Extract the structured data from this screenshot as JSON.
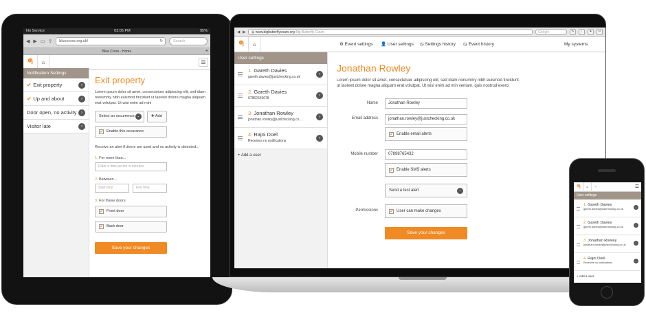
{
  "tablet": {
    "status": {
      "carrier": "No Service",
      "time": "03:05 PM",
      "battery": "95%"
    },
    "url": "bluecross.org.uk/",
    "search_placeholder": "Search",
    "tab_title": "Blue Cross - Home",
    "sidebar": {
      "heading": "Notification Settings",
      "items": [
        {
          "label": "Exit property",
          "checked": true
        },
        {
          "label": "Up and about",
          "checked": true
        },
        {
          "label": "Door open, no activity",
          "checked": false
        },
        {
          "label": "Visitor late",
          "checked": false
        }
      ]
    },
    "main": {
      "title": "Exit property",
      "lorem": "Lorem ipsum dolor sit amet, consectetuer adipiscing elit, sed diam nonummy nibh euismod tincidunt ut laoreet dolore magna aliquam erat volutpat. Ut wisi enim ad mini",
      "select_label": "Select an occurrence",
      "add_label": "Add",
      "enable_label": "Enable this occurance",
      "alert_text": "Receive an alert if doors are used and no activity is detected...",
      "step1": {
        "num": "1.",
        "label": "For more than..."
      },
      "step1_placeholder": "Enter a time period in minutes",
      "step2": {
        "num": "2.",
        "label": "Between..."
      },
      "start_placeholder": "Start time",
      "end_placeholder": "End time",
      "step3": {
        "num": "3.",
        "label": "For these doors"
      },
      "door1": "Front door",
      "door2": "Back door",
      "save": "Save your changes"
    }
  },
  "laptop": {
    "url_domain": "www.bigbutterflyexam.org",
    "url_title": "Big Butterfly Count",
    "search_placeholder": "Google",
    "nav": [
      "Event settings",
      "User settings",
      "Settings history",
      "Event history"
    ],
    "my_systems": "My systems",
    "users_heading": "User settings",
    "users": [
      {
        "num": "1.",
        "name": "Gareth Davies",
        "sub": "gareth.davies@justchecking.co.uk"
      },
      {
        "num": "2.",
        "name": "Gareth Davies",
        "sub": "07862345678"
      },
      {
        "num": "3.",
        "name": "Jonathan Rowley",
        "sub": "jonathan.rowley@justchecking.co..."
      },
      {
        "num": "4.",
        "name": "Rajni Doel",
        "sub": "Receives no notifications"
      }
    ],
    "add_user": "Add a user",
    "detail": {
      "title": "Jonathan Rowley",
      "lorem": "Lorem ipsum dolor sit amet, consectetuer adipiscing elit, sed diam nonummy nibh euismod tincidunt ut laoreet dolore magna aliquam erat volutpat. Ut wisi enim ad min veniam, quis nostrud exerci",
      "name_label": "Name",
      "name_value": "Jonathan Rowley",
      "email_label": "Email address",
      "email_value": "jonathan.rowley@justchecking.co.uk",
      "email_alerts": "Enable email alerts",
      "mobile_label": "Mobile number",
      "mobile_value": "07898765432",
      "sms_alerts": "Enable SMS alerts",
      "test_alert": "Send a test alert",
      "perm_label": "Permissions",
      "perm_value": "User can make changes",
      "save": "Save your changes"
    }
  },
  "phone": {
    "users_heading": "User settings",
    "users": [
      {
        "num": "1.",
        "name": "Gareth Davies",
        "sub": "gareth.davies@justchecking.co.uk"
      },
      {
        "num": "2.",
        "name": "Gareth Davies",
        "sub": "gareth.davies@justchecking.co.uk"
      },
      {
        "num": "3.",
        "name": "Jonathan Rowley",
        "sub": "jonathan.rowley@justchecking.co.uk"
      },
      {
        "num": "4.",
        "name": "Rajni Doel",
        "sub": "Receives no notifications"
      }
    ],
    "add_user": "Add a user"
  },
  "colors": {
    "accent": "#f08a24",
    "panel_head": "#a1958a"
  }
}
